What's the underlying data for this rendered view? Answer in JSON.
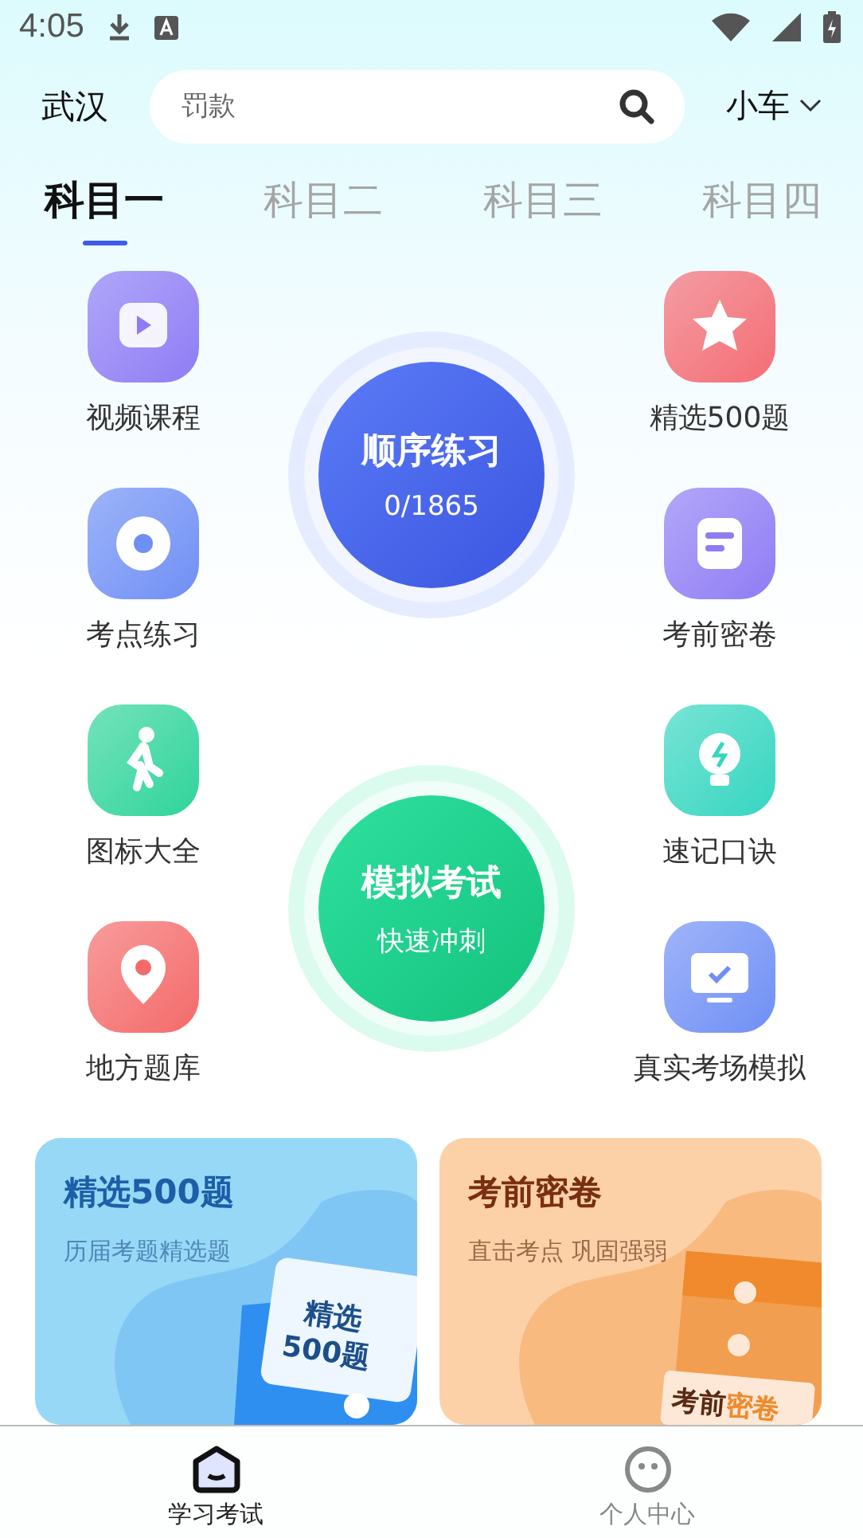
{
  "status_bar": {
    "time": "4:05"
  },
  "header": {
    "city": "武汉",
    "search": {
      "placeholder": "罚款"
    },
    "vehicle": "小车"
  },
  "tabs": [
    {
      "label": "科目一",
      "selected": true
    },
    {
      "label": "科目二",
      "selected": false
    },
    {
      "label": "科目三",
      "selected": false
    },
    {
      "label": "科目四",
      "selected": false
    }
  ],
  "left_features": [
    {
      "label": "视频课程",
      "kind": "video",
      "color": "#8f7cf5"
    },
    {
      "label": "考点练习",
      "kind": "disc",
      "color": "#6f8ff5"
    },
    {
      "label": "图标大全",
      "kind": "walker",
      "color": "#2fd49a"
    },
    {
      "label": "地方题库",
      "kind": "pin",
      "color": "#f46a6a"
    }
  ],
  "right_features": [
    {
      "label": "精选500题",
      "kind": "star",
      "color": "#f56d75"
    },
    {
      "label": "考前密卷",
      "kind": "doc",
      "color": "#8f7cf5"
    },
    {
      "label": "速记口诀",
      "kind": "bulb",
      "color": "#35d6c0"
    },
    {
      "label": "真实考场模拟",
      "kind": "monitor",
      "color": "#6f8ff5"
    }
  ],
  "practice": {
    "title": "顺序练习",
    "progress": "0/1865"
  },
  "exam": {
    "title": "模拟考试",
    "subtitle": "快速冲刺"
  },
  "cards": [
    {
      "kind": "blue",
      "title": "精选500题",
      "subtitle": "历届考题精选题",
      "art_line1": "精选",
      "art_line2": "500题"
    },
    {
      "kind": "orange",
      "title": "考前密卷",
      "subtitle": "直击考点 巩固强弱",
      "art_line1": "考前",
      "art_line2": "密卷"
    }
  ],
  "bottom_nav": [
    {
      "label": "学习考试",
      "kind": "home",
      "selected": true
    },
    {
      "label": "个人中心",
      "kind": "face",
      "selected": false
    }
  ]
}
